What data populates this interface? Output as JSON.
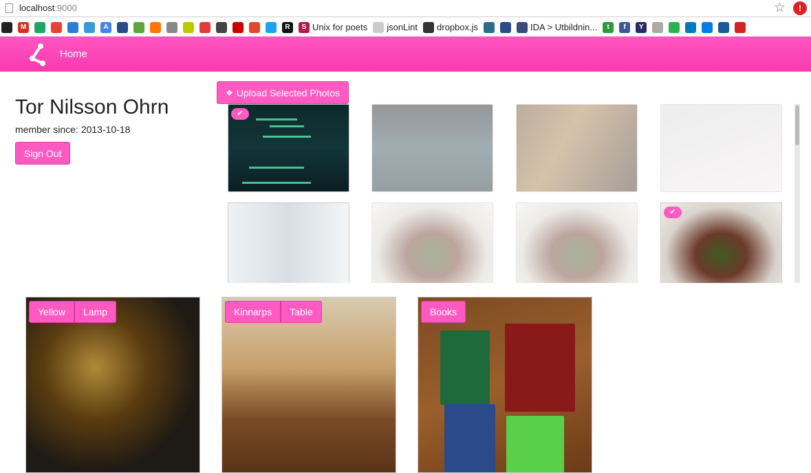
{
  "browser": {
    "url_host": "localhost",
    "url_port": ":9000",
    "extension_badge": "!"
  },
  "bookmarks": [
    {
      "icon": "github-icon",
      "color": "#222222",
      "glyph": "",
      "label": ""
    },
    {
      "icon": "gmail-icon",
      "color": "#d93025",
      "glyph": "M",
      "label": ""
    },
    {
      "icon": "drive-icon",
      "color": "#1fa463",
      "glyph": "",
      "label": ""
    },
    {
      "icon": "chrome-icon",
      "color": "#e94235",
      "glyph": "",
      "label": ""
    },
    {
      "icon": "refresh-icon",
      "color": "#2a7fd4",
      "glyph": "",
      "label": ""
    },
    {
      "icon": "sync-icon",
      "color": "#3a9ad9",
      "glyph": "",
      "label": ""
    },
    {
      "icon": "translate-icon",
      "color": "#4285f4",
      "glyph": "A",
      "label": ""
    },
    {
      "icon": "bow-icon",
      "color": "#2b4a8a",
      "glyph": "",
      "label": ""
    },
    {
      "icon": "puzzle-icon",
      "color": "#5aa63a",
      "glyph": "",
      "label": ""
    },
    {
      "icon": "soundcloud-icon",
      "color": "#ff7700",
      "glyph": "",
      "label": ""
    },
    {
      "icon": "tex-icon",
      "color": "#888888",
      "glyph": "",
      "label": ""
    },
    {
      "icon": "square-icon",
      "color": "#c0c800",
      "glyph": "",
      "label": ""
    },
    {
      "icon": "heart-icon",
      "color": "#e23a3a",
      "glyph": "",
      "label": ""
    },
    {
      "icon": "code-icon",
      "color": "#444444",
      "glyph": "",
      "label": ""
    },
    {
      "icon": "youtube-icon",
      "color": "#cc0000",
      "glyph": "",
      "label": ""
    },
    {
      "icon": "splat-icon",
      "color": "#e04a2a",
      "glyph": "",
      "label": ""
    },
    {
      "icon": "twitter-icon",
      "color": "#1da1f2",
      "glyph": "",
      "label": ""
    },
    {
      "icon": "r-icon",
      "color": "#111111",
      "glyph": "R",
      "label": ""
    },
    {
      "icon": "s-icon",
      "color": "#b5174d",
      "glyph": "S",
      "label": "Unix for poets"
    },
    {
      "icon": "dots-icon",
      "color": "#cccccc",
      "glyph": "",
      "label": "jsonLint"
    },
    {
      "icon": "dropbox-cat-icon",
      "color": "#333333",
      "glyph": "",
      "label": "dropbox.js"
    },
    {
      "icon": "photo-icon",
      "color": "#2a6d8a",
      "glyph": "",
      "label": ""
    },
    {
      "icon": "bow-icon",
      "color": "#2b4a8a",
      "glyph": "",
      "label": ""
    },
    {
      "icon": "ida-icon",
      "color": "#3a4a7a",
      "glyph": "",
      "label": "IDA > Utbildnin..."
    },
    {
      "icon": "t-icon",
      "color": "#2a9a3a",
      "glyph": "t",
      "label": ""
    },
    {
      "icon": "facebook-icon",
      "color": "#3b5998",
      "glyph": "f",
      "label": ""
    },
    {
      "icon": "yahoo-icon",
      "color": "#2a2a6a",
      "glyph": "Y",
      "label": ""
    },
    {
      "icon": "face-icon",
      "color": "#aaaaaa",
      "glyph": "",
      "label": ""
    },
    {
      "icon": "feedly-icon",
      "color": "#2bb24c",
      "glyph": "",
      "label": ""
    },
    {
      "icon": "trello-icon",
      "color": "#0079bf",
      "glyph": "",
      "label": ""
    },
    {
      "icon": "dropbox-icon",
      "color": "#007ee5",
      "glyph": "",
      "label": ""
    },
    {
      "icon": "mail-icon",
      "color": "#1a5a9a",
      "glyph": "",
      "label": ""
    },
    {
      "icon": "cut-icon",
      "color": "#d22222",
      "glyph": "",
      "label": ""
    }
  ],
  "navbar": {
    "home_label": "Home"
  },
  "profile": {
    "name": "Tor Nilsson Ohrn",
    "member_label": "member since:",
    "member_since": "2013-10-18",
    "sign_out_label": "Sign Out"
  },
  "upload": {
    "label": "Upload Selected Photos"
  },
  "photos": [
    {
      "kind": "terminal",
      "selected": true,
      "faded": false
    },
    {
      "kind": "screen",
      "selected": false,
      "faded": true
    },
    {
      "kind": "party",
      "selected": false,
      "faded": true
    },
    {
      "kind": "paper",
      "selected": false,
      "faded": true
    },
    {
      "kind": "office",
      "selected": false,
      "faded": false
    },
    {
      "kind": "food",
      "selected": false,
      "faded": true
    },
    {
      "kind": "food",
      "selected": false,
      "faded": true
    },
    {
      "kind": "food",
      "selected": true,
      "faded": false
    }
  ],
  "items": [
    {
      "photo": "lamp",
      "tags": [
        "Yellow",
        "Lamp"
      ]
    },
    {
      "photo": "table",
      "tags": [
        "Kinnarps",
        "Table"
      ]
    },
    {
      "photo": "books",
      "tags": [
        "Books"
      ]
    }
  ],
  "colors": {
    "accent": "#ff59c2",
    "accent_border": "#e23aa7"
  }
}
